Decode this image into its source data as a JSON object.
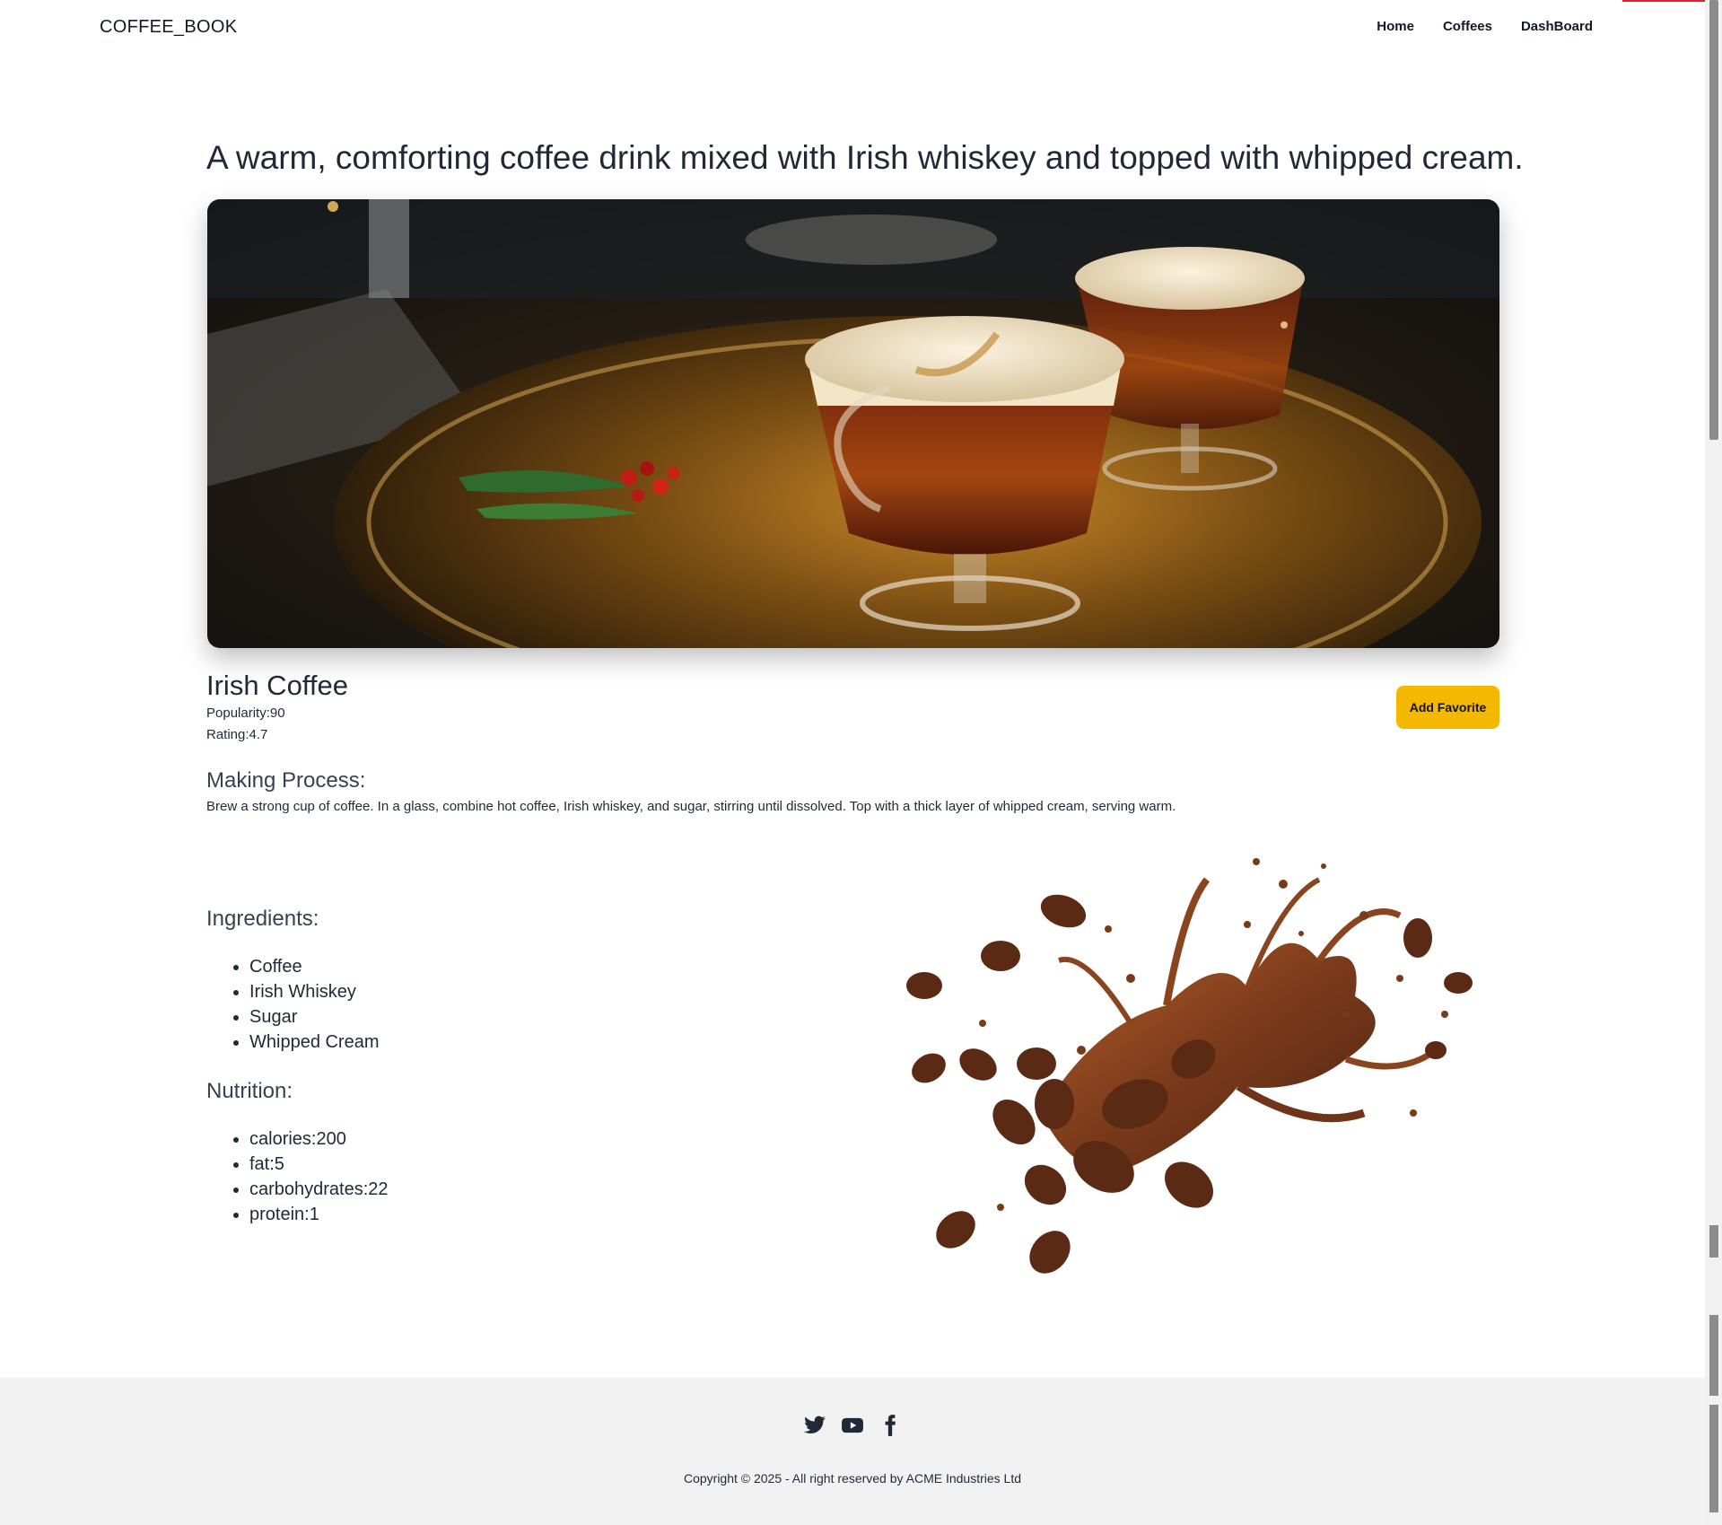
{
  "nav": {
    "brand": "COFFEE_BOOK",
    "links": [
      "Home",
      "Coffees",
      "DashBoard"
    ]
  },
  "coffee": {
    "description": "A warm, comforting coffee drink mixed with Irish whiskey and topped with whipped cream.",
    "name": "Irish Coffee",
    "popularity": "Popularity:90",
    "rating": "Rating:4.7",
    "add_favorite_label": "Add Favorite",
    "making_process_title": "Making Process:",
    "making_process": "Brew a strong cup of coffee. In a glass, combine hot coffee, Irish whiskey, and sugar, stirring until dissolved. Top with a thick layer of whipped cream, serving warm.",
    "ingredients_title": "Ingredients:",
    "ingredients": [
      "Coffee",
      "Irish Whiskey",
      "Sugar",
      "Whipped Cream"
    ],
    "nutrition_title": "Nutrition:",
    "nutrition": [
      "calories:200",
      "fat:5",
      "carbohydrates:22",
      "protein:1"
    ]
  },
  "footer": {
    "social_icons": [
      "twitter-icon",
      "youtube-icon",
      "facebook-icon"
    ],
    "copyright": "Copyright © 2025 - All right reserved by ACME Industries Ltd"
  },
  "colors": {
    "accent": "#f5b800",
    "footer_bg": "#f2f2f2",
    "text": "#1f2937"
  }
}
